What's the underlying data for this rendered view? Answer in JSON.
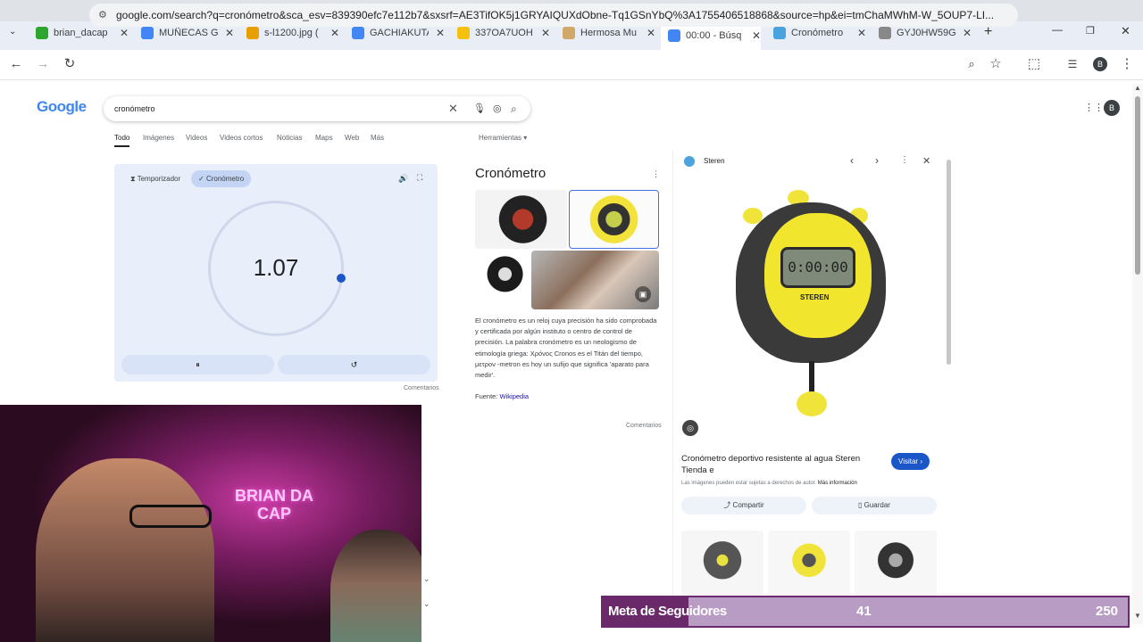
{
  "tabs": [
    {
      "title": "brian_dacap",
      "color": "#2ea52e",
      "active": false
    },
    {
      "title": "MUÑECAS G",
      "color": "#4285f4",
      "active": false
    },
    {
      "title": "s-l1200.jpg (",
      "color": "#e8a000",
      "active": false
    },
    {
      "title": "GACHIAKUTA",
      "color": "#4285f4",
      "active": false
    },
    {
      "title": "337OA7UOH",
      "color": "#f4c20d",
      "active": false
    },
    {
      "title": "Hermosa Mu",
      "color": "#d2a86a",
      "active": false
    },
    {
      "title": "00:00 - Búsq",
      "color": "#4285f4",
      "active": true
    },
    {
      "title": "Cronómetro",
      "color": "#4aa3df",
      "active": false
    },
    {
      "title": "GYJ0HW59G",
      "color": "#888888",
      "active": false
    }
  ],
  "toolbar": {
    "url": "google.com/search?q=cronómetro&sca_esv=839390efc7e112b7&sxsrf=AE3TifOK5j1GRYAIQUXdObne-Tq1GSnYbQ%3A1755406518868&source=hp&ei=tmChaMWhM-W_5OUP7-LI...",
    "profile_letter": "B"
  },
  "google": {
    "logo": "Google",
    "query": "cronómetro",
    "nav_tabs": [
      "Todo",
      "Imágenes",
      "Videos",
      "Videos cortos",
      "Noticias",
      "Maps",
      "Web",
      "Más"
    ],
    "tools": "Herramientas",
    "avatar": "B"
  },
  "stopwatch": {
    "timer_label": "Temporizador",
    "stopwatch_label": "Cronómetro",
    "time": "1.07",
    "feedback": "Comentarios"
  },
  "knowledge_panel": {
    "title": "Cronómetro",
    "description": "El cronómetro es un reloj cuya precisión ha sido comprobada y certificada por algún instituto o centro de control de precisión. La palabra cronómetro es un neologismo de etimología griega: Χρόνος Cronos es el Titán del tiempo, μετρον -metron es hoy un sufijo que significa 'aparato para medir'.",
    "source_label": "Fuente:",
    "source_link": "Wikipedia",
    "feedback": "Comentarios"
  },
  "viewer": {
    "site": "Steren",
    "caption": "Cronómetro deportivo resistente al agua Steren Tienda e",
    "visit": "Visitar",
    "rights": "Las imágenes pueden estar sujetas a derechos de autor.",
    "more_info": "Más información",
    "share": "Compartir",
    "save": "Guardar",
    "brand_on_device": "STEREN",
    "lcd": "0:00:00"
  },
  "overlay": {
    "goal_label": "Meta de Seguidores",
    "current": "41",
    "target": "250",
    "progress": 0.164,
    "neon_text": "BRIAN DA CAP"
  }
}
